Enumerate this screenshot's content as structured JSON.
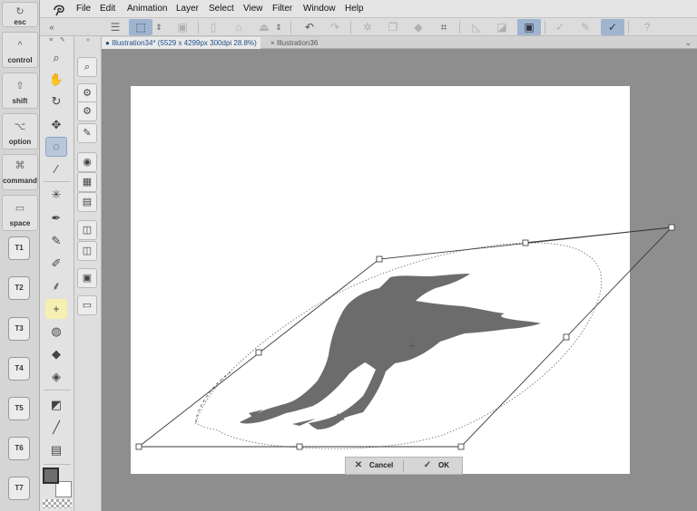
{
  "keys": {
    "esc": "esc",
    "control": "control",
    "shift": "shift",
    "option": "option",
    "command": "command",
    "space": "space",
    "t_keys": [
      "T1",
      "T2",
      "T3",
      "T4",
      "T5",
      "T6",
      "T7"
    ],
    "glyphs": {
      "esc": "↻",
      "control": "^",
      "shift": "⇧",
      "option": "⌥",
      "command": "⌘",
      "space": "▭"
    }
  },
  "menubar": {
    "items": [
      "File",
      "Edit",
      "Animation",
      "Layer",
      "Select",
      "View",
      "Filter",
      "Window",
      "Help"
    ]
  },
  "tabs": {
    "active": "Illustration34* (5529 x 4299px 300dpi 28.8%)",
    "inactive": "Illustration36",
    "active_marker": "●",
    "close_glyph": "×"
  },
  "confirm": {
    "cancel_label": "Cancel",
    "ok_label": "OK",
    "cancel_icon": "close-icon",
    "ok_icon": "check-circle-icon"
  },
  "colors": {
    "accent": "#9fb4cf",
    "main_color": "#6e6e6e",
    "sub_color": "#ffffff",
    "canvas": "#ffffff",
    "workspace": "#8e8e8e"
  },
  "tools": [
    "zoom-icon",
    "hand-icon",
    "rotate-view-icon",
    "move-icon",
    "lasso-select-icon",
    "eyedropper-icon",
    "magic-wand-icon",
    "pen-icon",
    "pencil-icon",
    "brush-icon",
    "airbrush-icon",
    "decoration-icon",
    "blend-icon",
    "fill-icon",
    "eraser-icon",
    "gradient-icon",
    "line-figure-icon",
    "frame-icon"
  ]
}
